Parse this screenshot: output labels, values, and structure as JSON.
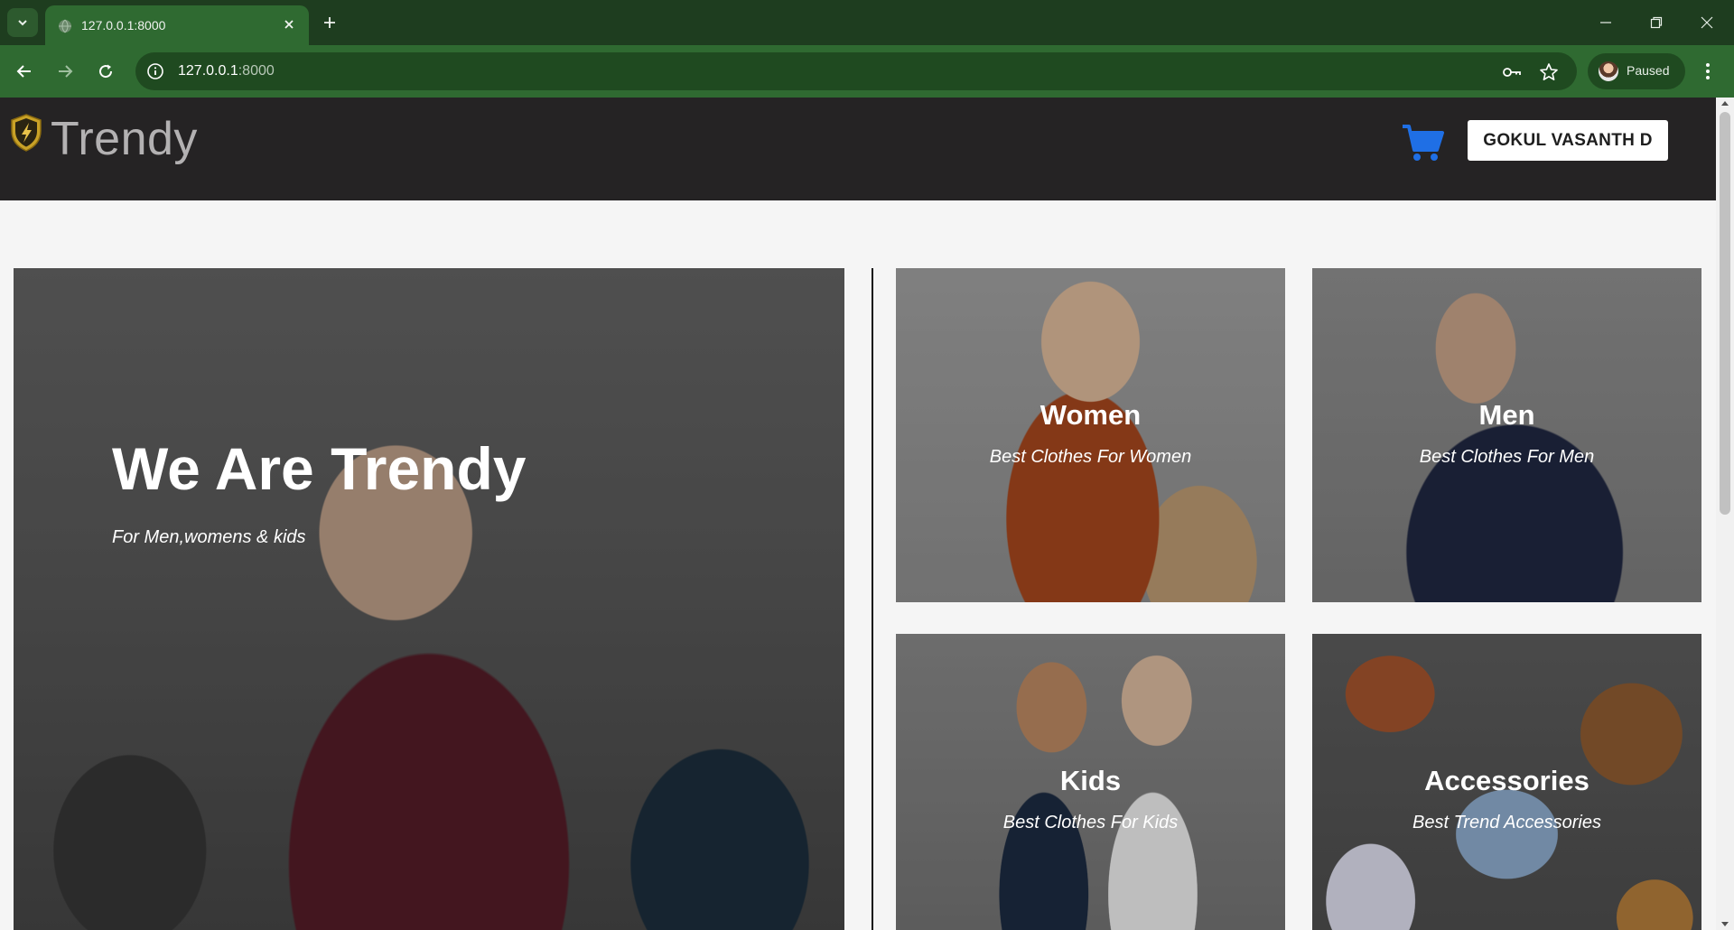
{
  "browser": {
    "tab_title": "127.0.0.1:8000",
    "url_host": "127.0.0.1",
    "url_port": ":8000",
    "profile_label": "Paused"
  },
  "site": {
    "logo_text": "Trendy",
    "user_button": "GOKUL VASANTH D",
    "accent_color": "#1f6fe5",
    "header_bg": "#252324"
  },
  "hero": {
    "title": "We Are Trendy",
    "subtitle": "For Men,womens & kids"
  },
  "categories": [
    {
      "title": "Women",
      "subtitle": "Best Clothes For Women"
    },
    {
      "title": "Men",
      "subtitle": "Best Clothes For Men"
    },
    {
      "title": "Kids",
      "subtitle": "Best Clothes For Kids"
    },
    {
      "title": "Accessories",
      "subtitle": "Best Trend Accessories"
    }
  ],
  "icons": {
    "tab_search": "chevron-down-icon",
    "favicon": "globe-icon",
    "close": "close-icon",
    "new_tab": "plus-icon",
    "back": "arrow-left-icon",
    "forward": "arrow-right-icon",
    "reload": "reload-icon",
    "site_info": "info-icon",
    "passwords": "key-icon",
    "bookmark": "star-icon",
    "menu": "kebab-menu-icon",
    "cart": "cart-icon",
    "logo": "shield-logo-icon"
  }
}
